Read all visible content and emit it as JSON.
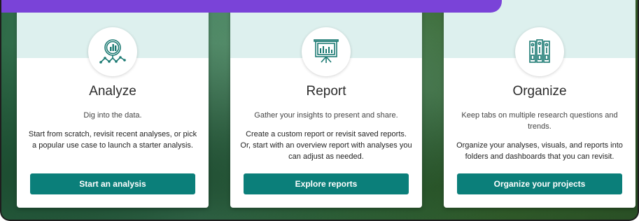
{
  "cards": [
    {
      "title": "Analyze",
      "subtitle": "Dig into the data.",
      "description": "Start from scratch, revisit recent analyses, or pick a popular use case to launch a starter analysis.",
      "button": "Start an analysis",
      "icon": "analyze-magnifier-chart-icon"
    },
    {
      "title": "Report",
      "subtitle": "Gather your insights to present and share.",
      "description": "Create a custom report or revisit saved reports. Or, start with an overview report with analyses you can adjust as needed.",
      "button": "Explore reports",
      "icon": "presentation-board-icon"
    },
    {
      "title": "Organize",
      "subtitle": "Keep tabs on multiple research questions and trends.",
      "description": "Organize your analyses, visuals, and reports into folders and dashboards that you can revisit.",
      "button": "Organize your projects",
      "icon": "binders-icon"
    }
  ],
  "colors": {
    "accent": "#0b7f7a",
    "band": "#ddf0ee",
    "topbar": "#7a43d8"
  }
}
